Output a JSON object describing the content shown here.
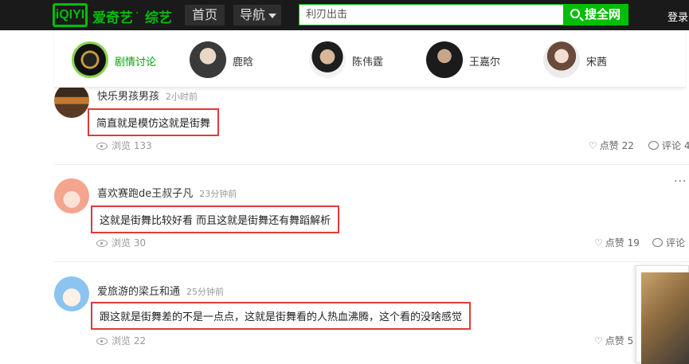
{
  "header": {
    "logo_text": "iQIYI",
    "brand": "爱奇艺",
    "dot": "·",
    "channel": "综艺",
    "nav_home": "首页",
    "nav_menu": "导航",
    "search_value": "利刃出击",
    "search_button": "搜全网",
    "login": "登录"
  },
  "stars": [
    {
      "name": "剧情讨论",
      "icon": "disc-avatar"
    },
    {
      "name": "鹿晗",
      "icon": "avatar"
    },
    {
      "name": "陈伟霆",
      "icon": "avatar"
    },
    {
      "name": "王嘉尔",
      "icon": "avatar"
    },
    {
      "name": "宋茜",
      "icon": "avatar"
    }
  ],
  "comments": [
    {
      "user": "快乐男孩男孩",
      "time": "2小时前",
      "text": "简直就是模仿这就是街舞",
      "views": "浏览 133",
      "likes": "点赞 22",
      "reply": "评论 4"
    },
    {
      "user": "喜欢赛跑de王叔子凡",
      "time": "23分钟前",
      "text": "这就是街舞比较好看 而且这就是街舞还有舞蹈解析",
      "views": "浏览 30",
      "likes": "点赞 19",
      "reply": "评论"
    },
    {
      "user": "爱旅游的梁丘和通",
      "time": "25分钟前",
      "text": "跟这就是街舞差的不是一点点，这就是街舞看的人热血沸腾，这个看的没啥感觉",
      "views": "浏览 22",
      "likes": "点赞 5",
      "reply": ""
    }
  ],
  "more_dots": "···",
  "colors": {
    "accent": "#00be06",
    "highlight_border": "#e03a3a",
    "topbar": "#1a1a1a"
  }
}
